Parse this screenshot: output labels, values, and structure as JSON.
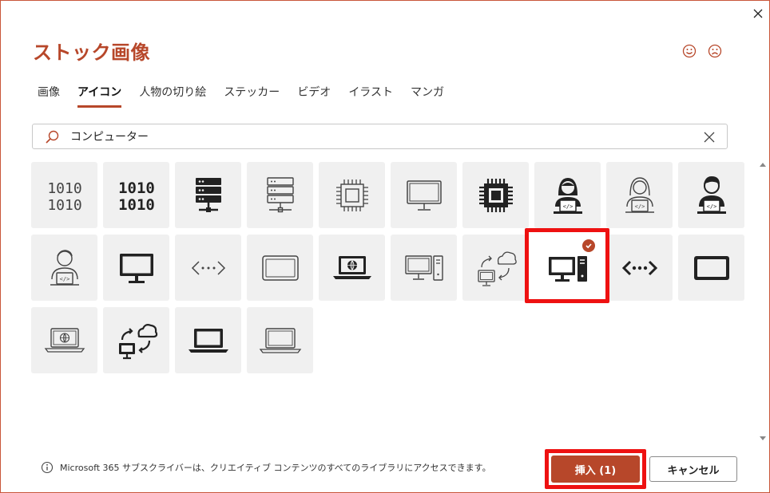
{
  "dialog": {
    "title": "ストック画像",
    "close_icon": "close-icon",
    "feedback": {
      "smile_icon": "smile-icon",
      "frown_icon": "frown-icon"
    }
  },
  "tabs": [
    {
      "label": "画像",
      "active": false
    },
    {
      "label": "アイコン",
      "active": true
    },
    {
      "label": "人物の切り絵",
      "active": false
    },
    {
      "label": "ステッカー",
      "active": false
    },
    {
      "label": "ビデオ",
      "active": false
    },
    {
      "label": "イラスト",
      "active": false
    },
    {
      "label": "マンガ",
      "active": false
    }
  ],
  "search": {
    "value": "コンピューター",
    "icon": "search-icon",
    "clear_icon": "clear-icon"
  },
  "icons": [
    {
      "name": "binary-outline-icon",
      "selected": false
    },
    {
      "name": "binary-bold-icon",
      "selected": false
    },
    {
      "name": "server-filled-icon",
      "selected": false
    },
    {
      "name": "server-outline-icon",
      "selected": false
    },
    {
      "name": "cpu-chip-outline-icon",
      "selected": false
    },
    {
      "name": "monitor-outline-icon",
      "selected": false
    },
    {
      "name": "cpu-chip-filled-icon",
      "selected": false
    },
    {
      "name": "programmer-woman-filled-icon",
      "selected": false
    },
    {
      "name": "programmer-woman-outline-icon",
      "selected": false
    },
    {
      "name": "programmer-man-filled-icon",
      "selected": false
    },
    {
      "name": "programmer-man-outline-icon",
      "selected": false
    },
    {
      "name": "monitor-filled-icon",
      "selected": false
    },
    {
      "name": "code-outline-icon",
      "selected": false
    },
    {
      "name": "tablet-outline-icon",
      "selected": false
    },
    {
      "name": "laptop-globe-filled-icon",
      "selected": false
    },
    {
      "name": "desktop-tower-outline-icon",
      "selected": false
    },
    {
      "name": "cloud-sync-outline-icon",
      "selected": false
    },
    {
      "name": "desktop-tower-filled-icon",
      "selected": true
    },
    {
      "name": "code-bold-icon",
      "selected": false
    },
    {
      "name": "tablet-filled-icon",
      "selected": false
    },
    {
      "name": "laptop-globe-outline-icon",
      "selected": false
    },
    {
      "name": "cloud-sync-filled-icon",
      "selected": false
    },
    {
      "name": "laptop-filled-icon",
      "selected": false
    },
    {
      "name": "laptop-outline-icon",
      "selected": false
    }
  ],
  "footer": {
    "info_text": "Microsoft 365 サブスクライバーは、クリエイティブ コンテンツのすべてのライブラリにアクセスできます。",
    "insert_label": "挿入 (1)",
    "cancel_label": "キャンセル"
  },
  "colors": {
    "accent": "#b7472a",
    "highlight": "#ee1111",
    "tile_bg": "#f0f0f0",
    "icon_dark": "#222222",
    "icon_outline": "#444444"
  }
}
